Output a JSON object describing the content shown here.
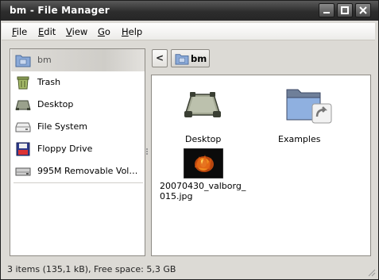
{
  "window": {
    "title": "bm - File Manager"
  },
  "menubar": {
    "items": [
      "File",
      "Edit",
      "View",
      "Go",
      "Help"
    ]
  },
  "sidepane": {
    "items": [
      {
        "label": "bm",
        "icon": "home-folder-icon",
        "selected": true
      },
      {
        "label": "Trash",
        "icon": "trash-icon"
      },
      {
        "label": "Desktop",
        "icon": "desktop-icon"
      },
      {
        "label": "File System",
        "icon": "harddisk-icon"
      },
      {
        "label": "Floppy Drive",
        "icon": "floppy-icon"
      },
      {
        "label": "995M Removable Vol…",
        "icon": "removable-drive-icon"
      }
    ]
  },
  "location": {
    "back_label": "<",
    "crumb": "bm"
  },
  "files": [
    {
      "name": "Desktop",
      "icon": "desktop-folder-icon"
    },
    {
      "name": "Examples",
      "icon": "folder-link-icon"
    },
    {
      "name_line1": "20070430_valborg_",
      "name_line2": "015.jpg",
      "icon": "image-thumbnail-icon"
    }
  ],
  "statusbar": {
    "text": "3 items (135,1 kB), Free space: 5,3 GB"
  },
  "colors": {
    "titlebar": "#2d2d2d",
    "window_bg": "#dcdad5",
    "folder_blue": "#7a9fd4"
  }
}
